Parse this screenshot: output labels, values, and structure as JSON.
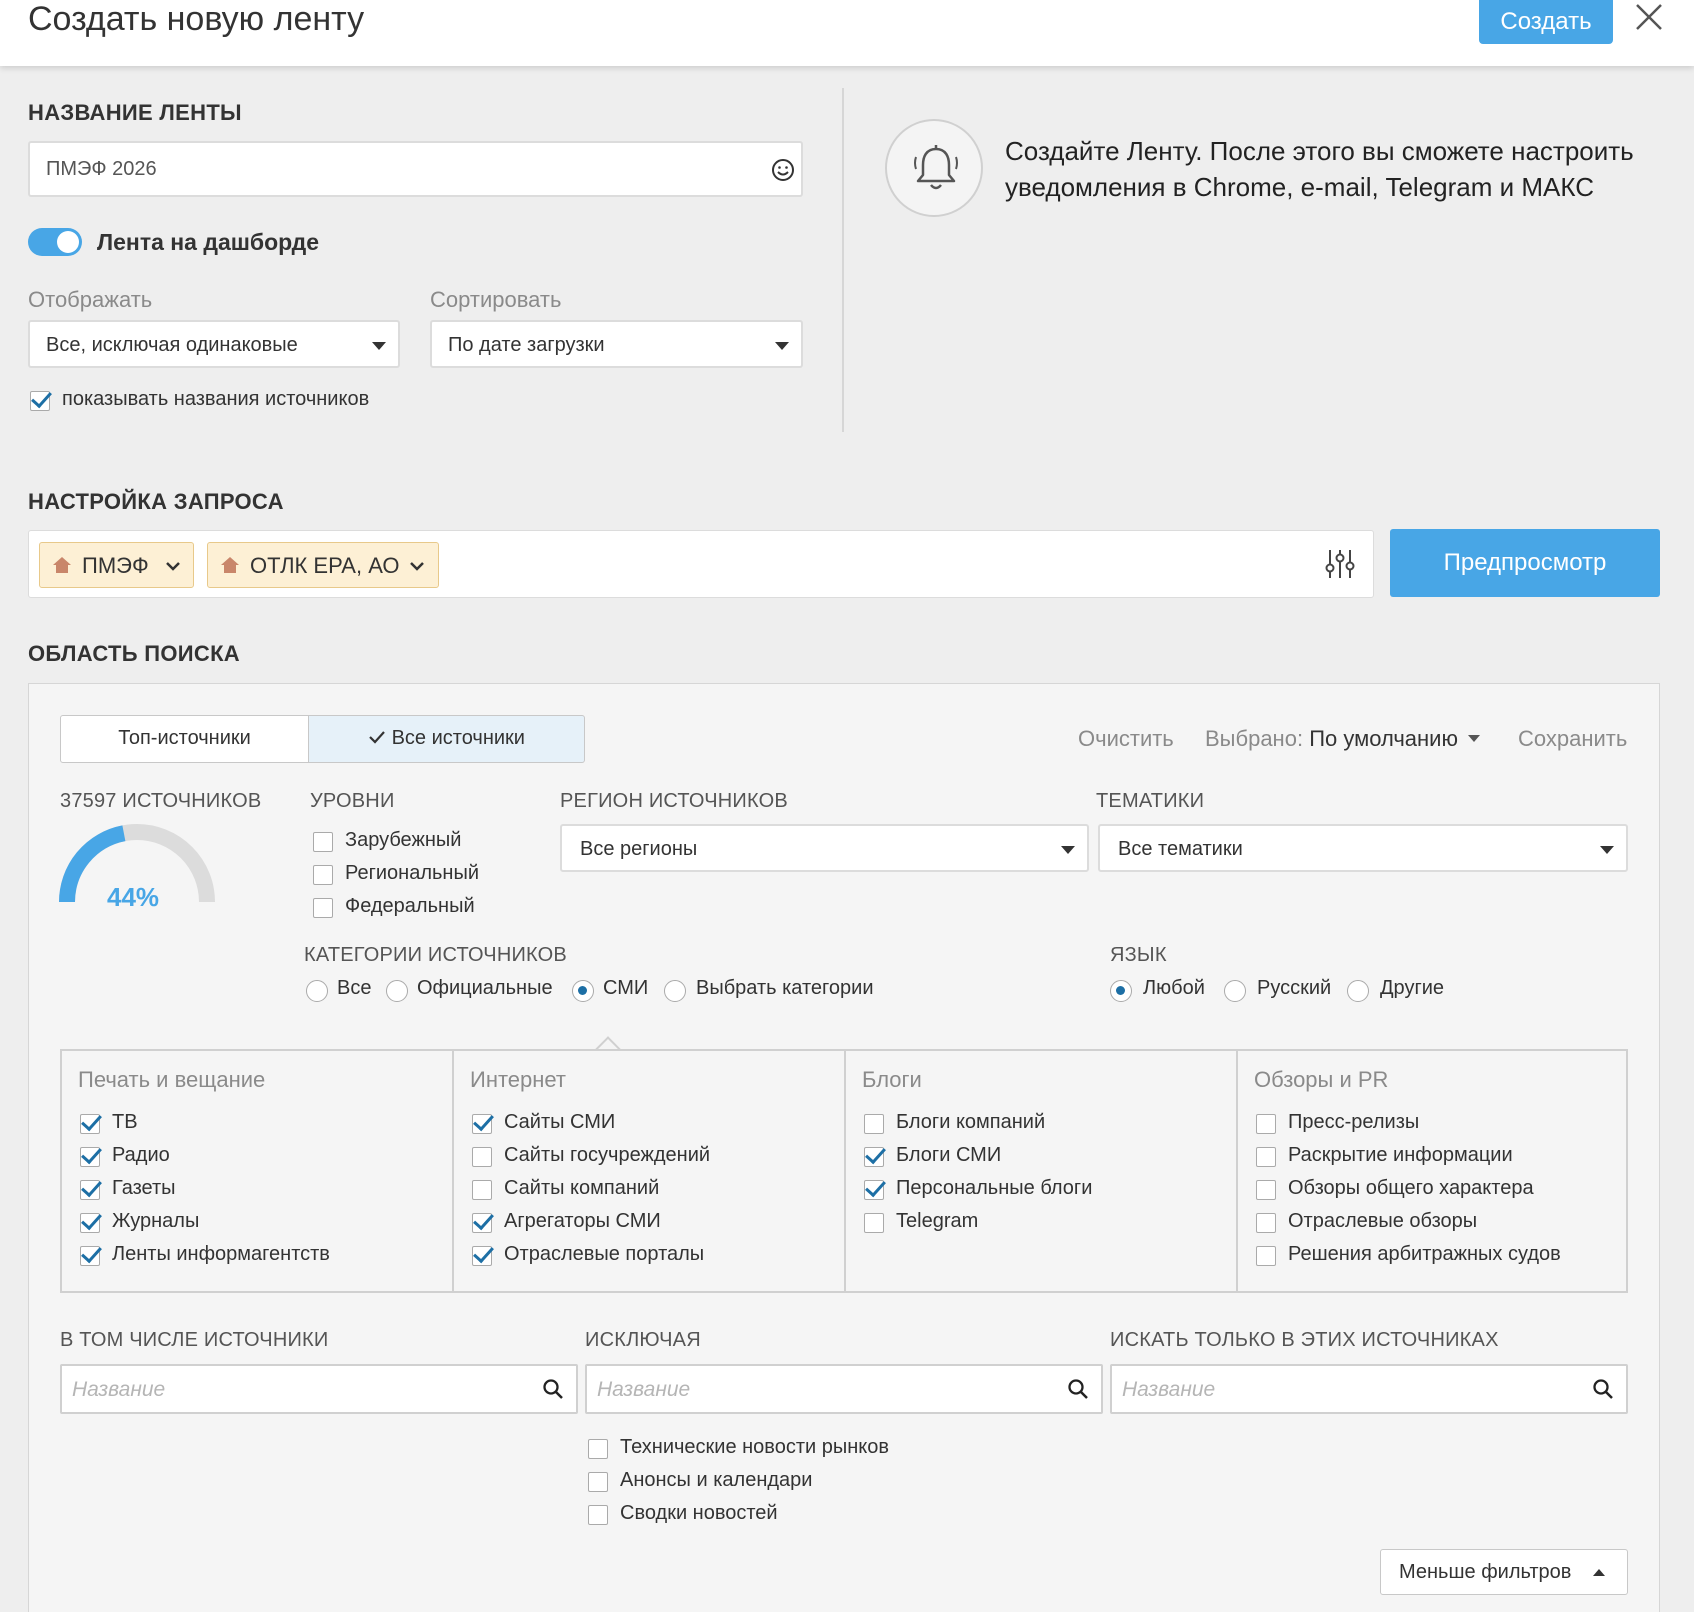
{
  "header": {
    "title": "Создать новую ленту",
    "create_label": "Создать"
  },
  "feed": {
    "section_title": "НАЗВАНИЕ ЛЕНТЫ",
    "name_value": "ПМЭФ 2026",
    "dashboard_toggle_label": "Лента на дашборде",
    "dashboard_toggle_on": true,
    "display_label": "Отображать",
    "display_value": "Все, исключая одинаковые",
    "sort_label": "Сортировать",
    "sort_value": "По дате загрузки",
    "show_source_names_label": "показывать названия источников",
    "show_source_names_checked": true
  },
  "notification": {
    "text": "Создайте Ленту. После этого вы сможете настроить уведомления в Chrome, e-mail, Telegram и МАКС"
  },
  "query": {
    "section_title": "НАСТРОЙКА ЗАПРОСА",
    "tags": [
      {
        "label": "ПМЭФ"
      },
      {
        "label": "ОТЛК ЕРА, АО"
      }
    ],
    "preview_label": "Предпросмотр"
  },
  "search_area": {
    "section_title": "ОБЛАСТЬ ПОИСКА",
    "tab_top": "Топ-источники",
    "tab_all": "Все источники",
    "clear_label": "Очистить",
    "selected_prefix": "Выбрано:",
    "selected_value": "По умолчанию",
    "save_label": "Сохранить",
    "sources_count_label": "37597 ИСТОЧНИКОВ",
    "gauge_percent": "44%",
    "gauge_fraction": 0.44,
    "levels": {
      "title": "УРОВНИ",
      "items": [
        {
          "label": "Зарубежный",
          "checked": false
        },
        {
          "label": "Региональный",
          "checked": false
        },
        {
          "label": "Федеральный",
          "checked": false
        }
      ]
    },
    "region": {
      "title": "РЕГИОН ИСТОЧНИКОВ",
      "value": "Все регионы"
    },
    "topics": {
      "title": "ТЕМАТИКИ",
      "value": "Все тематики"
    },
    "categories": {
      "title": "КАТЕГОРИИ ИСТОЧНИКОВ",
      "options": [
        {
          "label": "Все",
          "selected": false
        },
        {
          "label": "Официальные",
          "selected": false
        },
        {
          "label": "СМИ",
          "selected": true
        },
        {
          "label": "Выбрать категории",
          "selected": false
        }
      ]
    },
    "language": {
      "title": "ЯЗЫК",
      "options": [
        {
          "label": "Любой",
          "selected": true
        },
        {
          "label": "Русский",
          "selected": false
        },
        {
          "label": "Другие",
          "selected": false
        }
      ]
    },
    "category_groups": [
      {
        "title": "Печать и вещание",
        "items": [
          {
            "label": "ТВ",
            "checked": true
          },
          {
            "label": "Радио",
            "checked": true
          },
          {
            "label": "Газеты",
            "checked": true
          },
          {
            "label": "Журналы",
            "checked": true
          },
          {
            "label": "Ленты информагентств",
            "checked": true
          }
        ]
      },
      {
        "title": "Интернет",
        "items": [
          {
            "label": "Сайты СМИ",
            "checked": true
          },
          {
            "label": "Сайты госучреждений",
            "checked": false
          },
          {
            "label": "Сайты компаний",
            "checked": false
          },
          {
            "label": "Агрегаторы СМИ",
            "checked": true
          },
          {
            "label": "Отраслевые порталы",
            "checked": true
          }
        ]
      },
      {
        "title": "Блоги",
        "items": [
          {
            "label": "Блоги компаний",
            "checked": false
          },
          {
            "label": "Блоги СМИ",
            "checked": true
          },
          {
            "label": "Персональные блоги",
            "checked": true
          },
          {
            "label": "Telegram",
            "checked": false
          }
        ]
      },
      {
        "title": "Обзоры и PR",
        "items": [
          {
            "label": "Пресс-релизы",
            "checked": false
          },
          {
            "label": "Раскрытие информации",
            "checked": false
          },
          {
            "label": "Обзоры общего характера",
            "checked": false
          },
          {
            "label": "Отраслевые обзоры",
            "checked": false
          },
          {
            "label": "Решения арбитражных судов",
            "checked": false
          }
        ]
      }
    ],
    "include": {
      "title": "В ТОМ ЧИСЛЕ ИСТОЧНИКИ",
      "placeholder": "Название"
    },
    "exclude": {
      "title": "ИСКЛЮЧАЯ",
      "placeholder": "Название",
      "options": [
        {
          "label": "Технические новости рынков",
          "checked": false
        },
        {
          "label": "Анонсы и календари",
          "checked": false
        },
        {
          "label": "Сводки новостей",
          "checked": false
        }
      ]
    },
    "only_in": {
      "title": "ИСКАТЬ ТОЛЬКО В ЭТИХ ИСТОЧНИКАХ",
      "placeholder": "Название"
    },
    "less_filters_label": "Меньше фильтров"
  },
  "colors": {
    "accent": "#48a6e6",
    "check": "#1d6fa5",
    "tag_bg": "#fdf0d5",
    "tag_icon": "#c9866a"
  }
}
